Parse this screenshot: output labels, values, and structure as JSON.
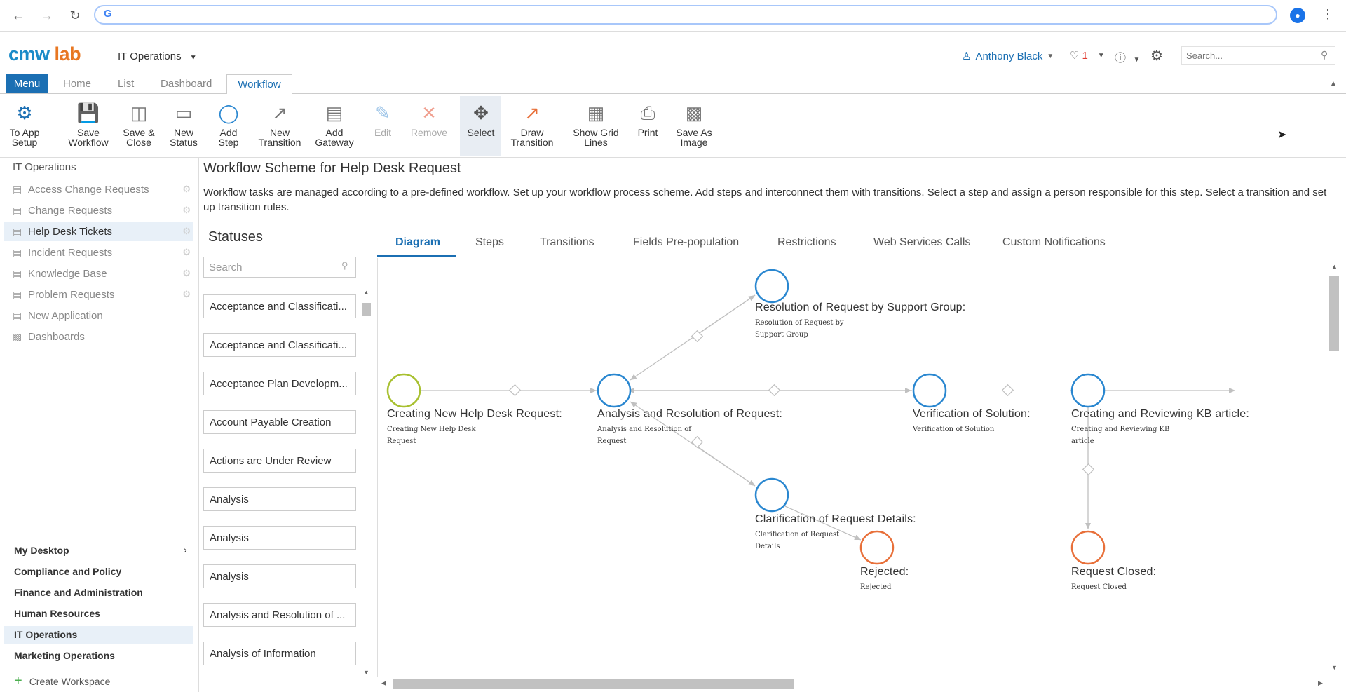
{
  "browser": {
    "url": "",
    "google_glyph": "G"
  },
  "header": {
    "logo_part1": "cmw",
    "logo_part2": "lab",
    "workspace": "IT Operations",
    "user": "Anthony Black",
    "notifications_count": "1",
    "search_placeholder": "Search..."
  },
  "nav_tabs": {
    "menu": "Menu",
    "home": "Home",
    "list": "List",
    "dashboard": "Dashboard",
    "workflow": "Workflow"
  },
  "toolbar": [
    {
      "label1": "To App",
      "label2": "Setup"
    },
    {
      "label1": "Save",
      "label2": "Workflow"
    },
    {
      "label1": "Save &",
      "label2": "Close"
    },
    {
      "label1": "New",
      "label2": "Status"
    },
    {
      "label1": "Add",
      "label2": "Step"
    },
    {
      "label1": "New",
      "label2": "Transition"
    },
    {
      "label1": "Add",
      "label2": "Gateway"
    },
    {
      "label1": "Edit",
      "label2": ""
    },
    {
      "label1": "Remove",
      "label2": ""
    },
    {
      "label1": "Select",
      "label2": ""
    },
    {
      "label1": "Draw",
      "label2": "Transition"
    },
    {
      "label1": "Show Grid",
      "label2": "Lines"
    },
    {
      "label1": "Print",
      "label2": ""
    },
    {
      "label1": "Save As",
      "label2": "Image"
    }
  ],
  "sidebar": {
    "root": "IT Operations",
    "items": [
      "Access Change Requests",
      "Change Requests",
      "Help Desk Tickets",
      "Incident Requests",
      "Knowledge Base",
      "Problem Requests",
      "New Application",
      "Dashboards"
    ],
    "workspaces": [
      "My Desktop",
      "Compliance and Policy",
      "Finance and Administration",
      "Human Resources",
      "IT Operations",
      "Marketing Operations"
    ],
    "create_workspace": "Create Workspace"
  },
  "main": {
    "title": "Workflow Scheme for Help Desk Request",
    "description": "Workflow tasks are managed according to a pre-defined workflow. Set up your workflow process scheme. Add steps and interconnect them with transitions. Select a step and assign a person responsible for this step. Select a transition and set up transition rules."
  },
  "statuses": {
    "title": "Statuses",
    "search_placeholder": "Search",
    "items": [
      "Acceptance and Classificati...",
      "Acceptance and Classificati...",
      "Acceptance Plan Developm...",
      "Account Payable Creation",
      "Actions are Under Review",
      "Analysis",
      "Analysis",
      "Analysis",
      "Analysis and Resolution of ...",
      "Analysis of Information"
    ]
  },
  "diagram_tabs": [
    "Diagram",
    "Steps",
    "Transitions",
    "Fields Pre-population",
    "Restrictions",
    "Web Services Calls",
    "Custom Notifications"
  ],
  "diagram": {
    "colors": {
      "start": "#a8c030",
      "step": "#2a87d0",
      "end": "#e8703a",
      "edge": "#c0c0c0"
    },
    "nodes": [
      {
        "title": "Resolution of Request by Support Group:",
        "sub1": "Resolution of Request by",
        "sub2": "Support Group",
        "kind": "step"
      },
      {
        "title": "Creating New Help Desk Request:",
        "sub1": "Creating New Help Desk",
        "sub2": "Request",
        "kind": "start"
      },
      {
        "title": "Analysis and Resolution of Request:",
        "sub1": "Analysis and Resolution of",
        "sub2": "Request",
        "kind": "step"
      },
      {
        "title": "Verification of Solution:",
        "sub1": "Verification of Solution",
        "sub2": "",
        "kind": "step"
      },
      {
        "title": "Creating and Reviewing KB article:",
        "sub1": "Creating and Reviewing KB",
        "sub2": "article",
        "kind": "step"
      },
      {
        "title": "Clarification of Request Details:",
        "sub1": "Clarification of Request",
        "sub2": "Details",
        "kind": "step"
      },
      {
        "title": "Rejected:",
        "sub1": "Rejected",
        "sub2": "",
        "kind": "end"
      },
      {
        "title": "Request Closed:",
        "sub1": "Request Closed",
        "sub2": "",
        "kind": "end"
      }
    ]
  }
}
